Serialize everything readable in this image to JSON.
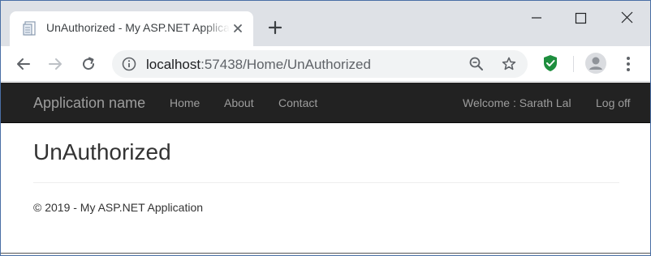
{
  "browser": {
    "tab": {
      "title": "UnAuthorized - My ASP.NET Application"
    },
    "address_bar": {
      "host": "localhost",
      "rest": ":57438/Home/UnAuthorized"
    },
    "colors": {
      "extension_accent": "#1e8e3e"
    },
    "icons": [
      "page-icon",
      "close-icon",
      "plus-icon",
      "minimize-icon",
      "maximize-icon",
      "close-window-icon",
      "back-arrow-icon",
      "forward-arrow-icon",
      "reload-icon",
      "info-icon",
      "zoom-out-icon",
      "star-icon",
      "shield-extension-icon",
      "profile-avatar-icon",
      "more-vert-icon"
    ]
  },
  "navbar": {
    "brand": "Application name",
    "links": [
      {
        "label": "Home"
      },
      {
        "label": "About"
      },
      {
        "label": "Contact"
      }
    ],
    "welcome": "Welcome : Sarath Lal",
    "logoff": "Log off"
  },
  "main": {
    "title": "UnAuthorized"
  },
  "footer": {
    "text": "© 2019 - My ASP.NET Application"
  }
}
